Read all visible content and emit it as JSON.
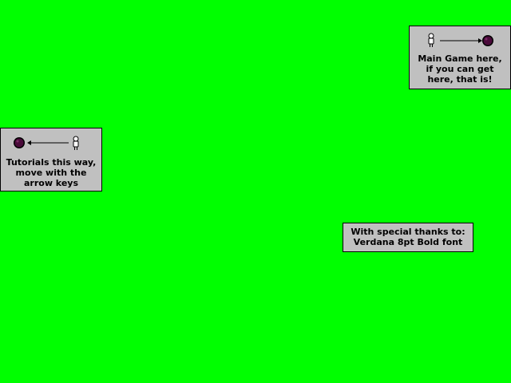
{
  "scene": {
    "background_color": "#00ff00",
    "sign_color": "#c0c0c0",
    "orb_color": "#4a0a3a"
  },
  "signs": {
    "main_game": {
      "arrow_direction": "right",
      "icons": [
        "player-icon",
        "arrow-icon",
        "portal-orb-icon"
      ],
      "lines": [
        "Main Game here,",
        "if you can get",
        "here, that is!"
      ]
    },
    "tutorials": {
      "arrow_direction": "left",
      "icons": [
        "portal-orb-icon",
        "arrow-icon",
        "player-icon"
      ],
      "lines": [
        "Tutorials this way,",
        "move with the",
        "arrow keys"
      ]
    },
    "credits": {
      "lines": [
        "With special thanks to:",
        "Verdana 8pt Bold font"
      ]
    }
  }
}
